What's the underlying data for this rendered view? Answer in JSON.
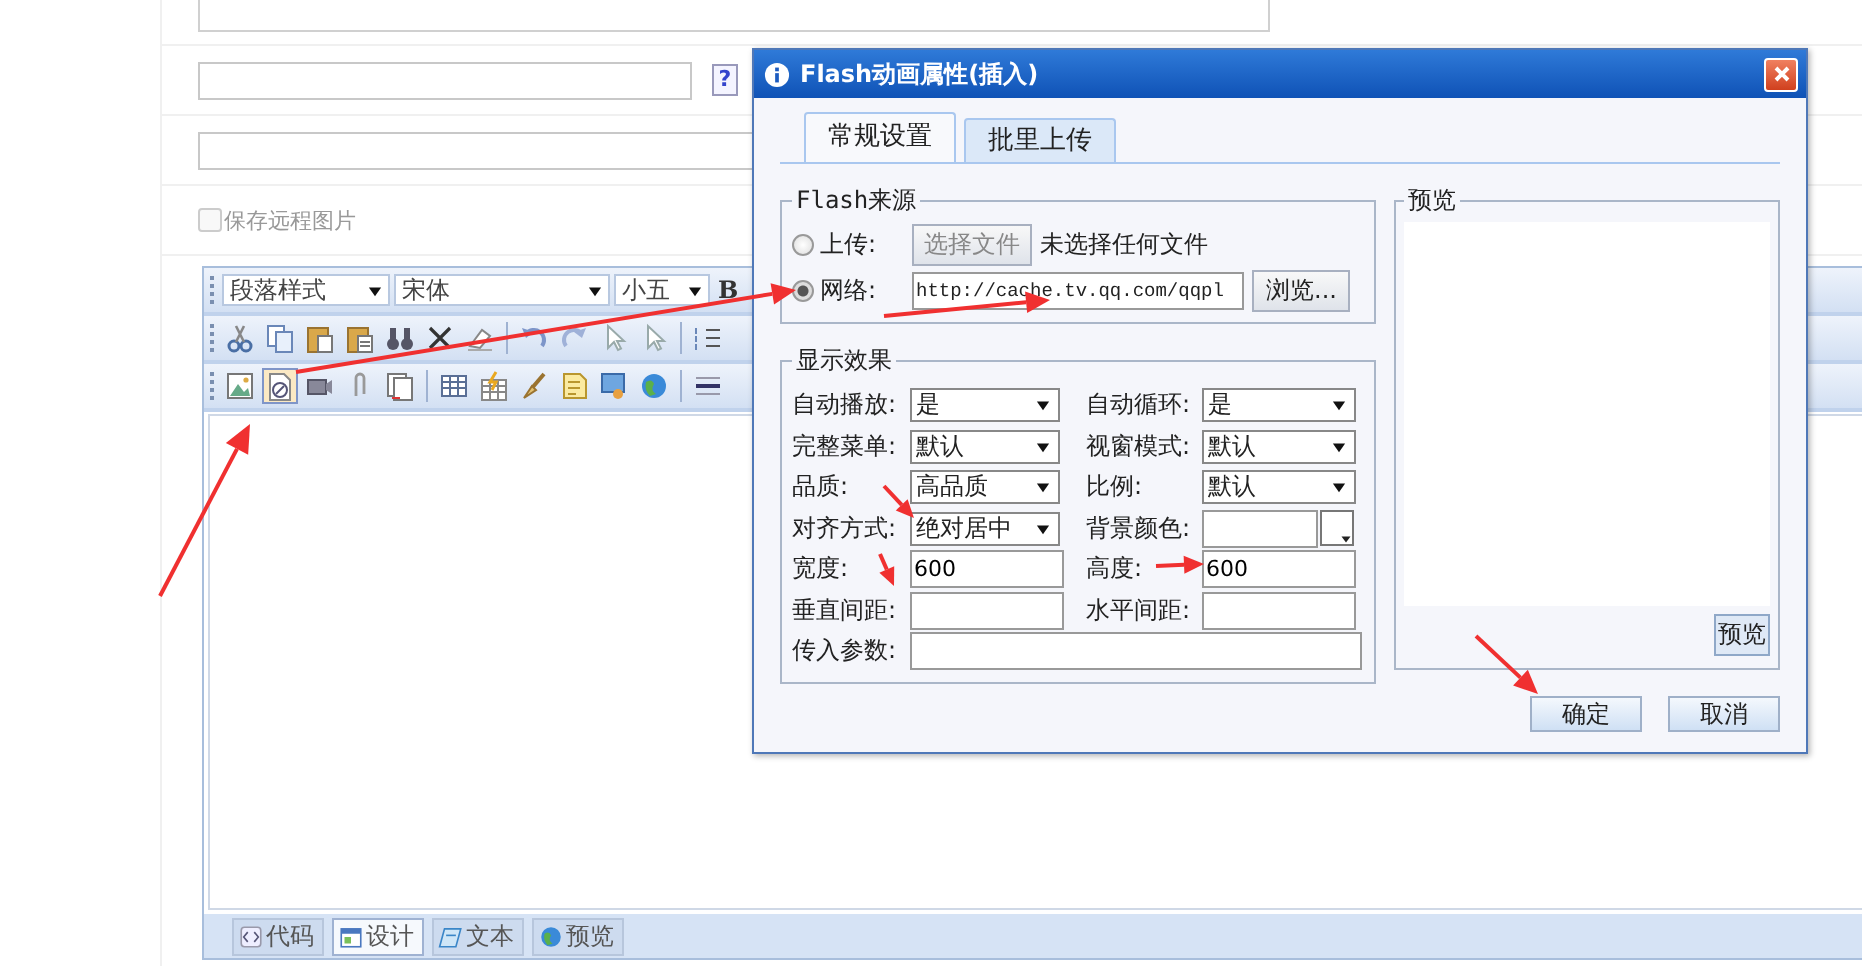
{
  "page": {
    "link_help": "?",
    "save_remote_images": {
      "label": "保存远程图片",
      "checked": false
    },
    "editor": {
      "selects": [
        {
          "value": "段落样式"
        },
        {
          "value": "宋体"
        },
        {
          "value": "小五"
        }
      ],
      "bold": "B",
      "toolbar_rows": [
        [
          {
            "kind": "cut",
            "active": false
          },
          {
            "kind": "copy",
            "active": false
          },
          {
            "kind": "paste",
            "active": false
          },
          {
            "kind": "paste-text",
            "active": false
          },
          {
            "kind": "find",
            "active": false
          },
          {
            "kind": "delete",
            "active": false
          },
          {
            "kind": "eraser",
            "active": false
          },
          {
            "kind": "separator"
          },
          {
            "kind": "undo",
            "active": false
          },
          {
            "kind": "redo",
            "active": false
          },
          {
            "kind": "pointer",
            "active": false
          },
          {
            "kind": "pointer",
            "active": false
          },
          {
            "kind": "separator"
          },
          {
            "kind": "ordered-list",
            "active": false
          }
        ],
        [
          {
            "kind": "image",
            "active": false
          },
          {
            "kind": "flash",
            "active": true
          },
          {
            "kind": "media",
            "active": false
          },
          {
            "kind": "attachment",
            "active": false
          },
          {
            "kind": "template",
            "active": false
          },
          {
            "kind": "separator"
          },
          {
            "kind": "table",
            "active": false
          },
          {
            "kind": "table-insert",
            "active": false
          },
          {
            "kind": "brush",
            "active": false
          },
          {
            "kind": "note",
            "active": false
          },
          {
            "kind": "monitor",
            "active": false
          },
          {
            "kind": "globe",
            "active": false
          },
          {
            "kind": "separator"
          },
          {
            "kind": "rule",
            "active": false
          }
        ]
      ],
      "modes": [
        {
          "kind": "code",
          "label": "代码",
          "selected": false
        },
        {
          "kind": "design",
          "label": "设计",
          "selected": true
        },
        {
          "kind": "text",
          "label": "文本",
          "selected": false
        },
        {
          "kind": "preview",
          "label": "预览",
          "selected": false
        }
      ]
    }
  },
  "dialog": {
    "title": "Flash动画属性(插入)",
    "tabs": [
      {
        "label": "常规设置",
        "selected": true
      },
      {
        "label": "批里上传",
        "selected": false
      }
    ],
    "source": {
      "legend": "Flash来源",
      "options": [
        {
          "label": "上传:",
          "selected": false
        },
        {
          "label": "网络:",
          "selected": true
        }
      ],
      "file_button": "选择文件",
      "file_status": "未选择任何文件",
      "url": "http://cache.tv.qq.com/qqpl",
      "browse_button": "浏览..."
    },
    "display": {
      "legend": "显示效果",
      "fields": [
        {
          "label": "自动播放:",
          "kind": "select",
          "value": "是"
        },
        {
          "label": "自动循环:",
          "kind": "select",
          "value": "是"
        },
        {
          "label": "完整菜单:",
          "kind": "select",
          "value": "默认"
        },
        {
          "label": "视窗模式:",
          "kind": "select",
          "value": "默认"
        },
        {
          "label": "品质:",
          "kind": "select",
          "value": "高品质"
        },
        {
          "label": "比例:",
          "kind": "select",
          "value": "默认"
        },
        {
          "label": "对齐方式:",
          "kind": "select",
          "value": "绝对居中"
        },
        {
          "label": "背景颜色:",
          "kind": "color"
        },
        {
          "label": "宽度:",
          "kind": "text",
          "value": "600"
        },
        {
          "label": "高度:",
          "kind": "text",
          "value": "600"
        },
        {
          "label": "垂直间距:",
          "kind": "text"
        },
        {
          "label": "水平间距:",
          "kind": "text"
        },
        {
          "label": "传入参数:",
          "kind": "wide"
        }
      ]
    },
    "preview": {
      "legend": "预览",
      "button": "预览"
    },
    "buttons": [
      "确定",
      "取消"
    ]
  }
}
